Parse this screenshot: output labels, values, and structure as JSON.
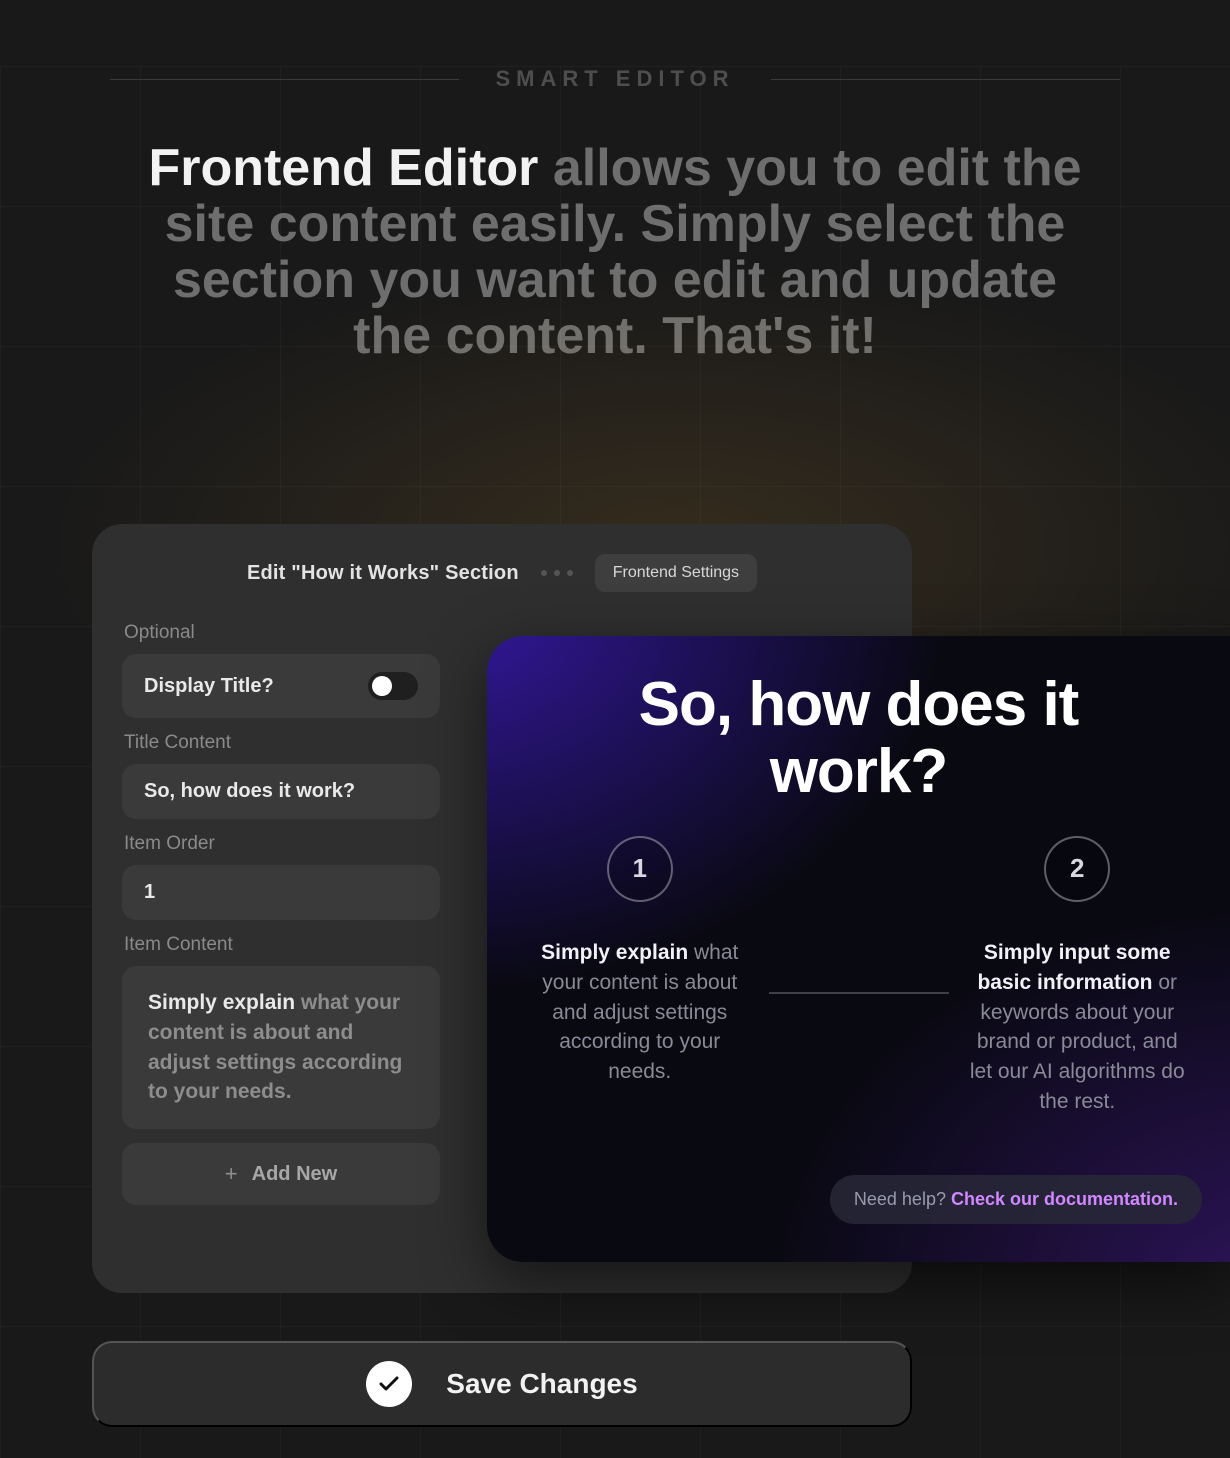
{
  "eyebrow": "SMART EDITOR",
  "headline": {
    "strong": "Frontend Editor",
    "rest": " allows you to edit the site content easily. Simply select the section you want to edit and update the content. That's it!"
  },
  "panel": {
    "title": "Edit \"How it Works\" Section",
    "settings_button": "Frontend Settings",
    "fields": {
      "optional_label": "Optional",
      "display_title_label": "Display Title?",
      "display_title_on": false,
      "title_content_label": "Title Content",
      "title_content_value": "So, how does it work?",
      "item_order_label": "Item Order",
      "item_order_value": "1",
      "item_content_label": "Item Content",
      "item_content_bold": "Simply explain",
      "item_content_rest": " what your content is about and adjust settings according to your needs.",
      "add_new_label": "Add New"
    }
  },
  "preview": {
    "title": "So, how does it work?",
    "steps": [
      {
        "num": "1",
        "bold": "Simply explain",
        "rest": " what your content is about and adjust settings according to your needs."
      },
      {
        "num": "2",
        "bold": "Simply input some basic information",
        "rest": " or keywords about your brand or product, and let our AI algorithms do the rest."
      }
    ],
    "doc_prompt": "Need help? ",
    "doc_link": "Check our documentation."
  },
  "save_button": "Save Changes"
}
